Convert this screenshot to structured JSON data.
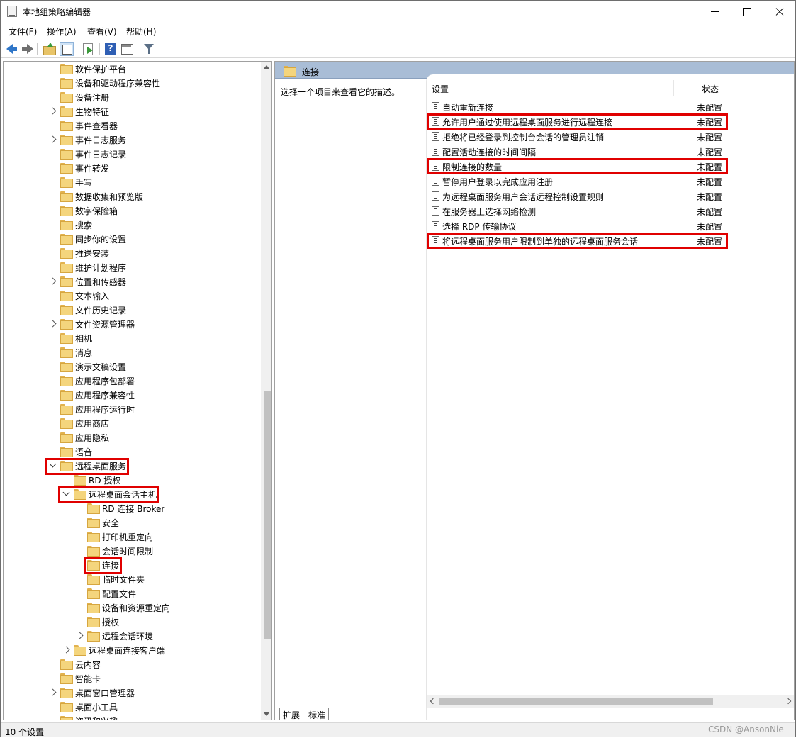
{
  "window": {
    "title": "本地组策略编辑器"
  },
  "menu": [
    "文件(F)",
    "操作(A)",
    "查看(V)",
    "帮助(H)"
  ],
  "toolbar_icons": [
    "back-arrow-icon",
    "forward-arrow-icon",
    "up-folder-icon",
    "show-hide-tree-icon",
    "export-list-icon",
    "help-icon",
    "view-pane-icon",
    "filter-icon"
  ],
  "tree": [
    {
      "label": "软件保护平台",
      "expander": "none",
      "level": 1
    },
    {
      "label": "设备和驱动程序兼容性",
      "expander": "none",
      "level": 1
    },
    {
      "label": "设备注册",
      "expander": "none",
      "level": 1
    },
    {
      "label": "生物特征",
      "expander": "collapsed",
      "level": 1
    },
    {
      "label": "事件查看器",
      "expander": "none",
      "level": 1
    },
    {
      "label": "事件日志服务",
      "expander": "collapsed",
      "level": 1
    },
    {
      "label": "事件日志记录",
      "expander": "none",
      "level": 1
    },
    {
      "label": "事件转发",
      "expander": "none",
      "level": 1
    },
    {
      "label": "手写",
      "expander": "none",
      "level": 1
    },
    {
      "label": "数据收集和预览版",
      "expander": "none",
      "level": 1
    },
    {
      "label": "数字保险箱",
      "expander": "none",
      "level": 1
    },
    {
      "label": "搜索",
      "expander": "none",
      "level": 1
    },
    {
      "label": "同步你的设置",
      "expander": "none",
      "level": 1
    },
    {
      "label": "推送安装",
      "expander": "none",
      "level": 1
    },
    {
      "label": "维护计划程序",
      "expander": "none",
      "level": 1
    },
    {
      "label": "位置和传感器",
      "expander": "collapsed",
      "level": 1
    },
    {
      "label": "文本输入",
      "expander": "none",
      "level": 1
    },
    {
      "label": "文件历史记录",
      "expander": "none",
      "level": 1
    },
    {
      "label": "文件资源管理器",
      "expander": "collapsed",
      "level": 1
    },
    {
      "label": "相机",
      "expander": "none",
      "level": 1
    },
    {
      "label": "消息",
      "expander": "none",
      "level": 1
    },
    {
      "label": "演示文稿设置",
      "expander": "none",
      "level": 1
    },
    {
      "label": "应用程序包部署",
      "expander": "none",
      "level": 1
    },
    {
      "label": "应用程序兼容性",
      "expander": "none",
      "level": 1
    },
    {
      "label": "应用程序运行时",
      "expander": "none",
      "level": 1
    },
    {
      "label": "应用商店",
      "expander": "none",
      "level": 1
    },
    {
      "label": "应用隐私",
      "expander": "none",
      "level": 1
    },
    {
      "label": "语音",
      "expander": "none",
      "level": 1
    },
    {
      "label": "远程桌面服务",
      "expander": "expanded",
      "level": 1,
      "highlight": true
    },
    {
      "label": "RD 授权",
      "expander": "none",
      "level": 2
    },
    {
      "label": "远程桌面会话主机",
      "expander": "expanded",
      "level": 2,
      "highlight": true
    },
    {
      "label": "RD 连接 Broker",
      "expander": "none",
      "level": 3
    },
    {
      "label": "安全",
      "expander": "none",
      "level": 3
    },
    {
      "label": "打印机重定向",
      "expander": "none",
      "level": 3
    },
    {
      "label": "会话时间限制",
      "expander": "none",
      "level": 3
    },
    {
      "label": "连接",
      "expander": "none",
      "level": 3,
      "highlight": true,
      "selected": true
    },
    {
      "label": "临时文件夹",
      "expander": "none",
      "level": 3
    },
    {
      "label": "配置文件",
      "expander": "none",
      "level": 3
    },
    {
      "label": "设备和资源重定向",
      "expander": "none",
      "level": 3
    },
    {
      "label": "授权",
      "expander": "none",
      "level": 3
    },
    {
      "label": "远程会话环境",
      "expander": "collapsed",
      "level": 3
    },
    {
      "label": "远程桌面连接客户端",
      "expander": "collapsed",
      "level": 2
    },
    {
      "label": "云内容",
      "expander": "none",
      "level": 1
    },
    {
      "label": "智能卡",
      "expander": "none",
      "level": 1
    },
    {
      "label": "桌面窗口管理器",
      "expander": "collapsed",
      "level": 1
    },
    {
      "label": "桌面小工具",
      "expander": "none",
      "level": 1
    },
    {
      "label": "资讯和兴趣",
      "expander": "none",
      "level": 1
    }
  ],
  "right_pane": {
    "header_title": "连接",
    "description": "选择一个项目来查看它的描述。",
    "col_setting": "设置",
    "col_state": "状态",
    "policies": [
      {
        "name": "自动重新连接",
        "state": "未配置",
        "highlight": false
      },
      {
        "name": "允许用户通过使用远程桌面服务进行远程连接",
        "state": "未配置",
        "highlight": true
      },
      {
        "name": "拒绝将已经登录到控制台会话的管理员注销",
        "state": "未配置",
        "highlight": false
      },
      {
        "name": "配置活动连接的时间间隔",
        "state": "未配置",
        "highlight": false
      },
      {
        "name": "限制连接的数量",
        "state": "未配置",
        "highlight": true
      },
      {
        "name": "暂停用户登录以完成应用注册",
        "state": "未配置",
        "highlight": false
      },
      {
        "name": "为远程桌面服务用户会话远程控制设置规则",
        "state": "未配置",
        "highlight": false
      },
      {
        "name": "在服务器上选择网络检测",
        "state": "未配置",
        "highlight": false
      },
      {
        "name": "选择 RDP 传输协议",
        "state": "未配置",
        "highlight": false
      },
      {
        "name": "将远程桌面服务用户限制到单独的远程桌面服务会话",
        "state": "未配置",
        "highlight": true
      }
    ],
    "tab_extended": "扩展",
    "tab_standard": "标准"
  },
  "status": {
    "text": "10 个设置",
    "watermark": "CSDN @AnsonNie"
  },
  "colors": {
    "highlight_border": "#e00000",
    "pane_header": "#a9bdd6",
    "folder": "#f4d57d"
  }
}
